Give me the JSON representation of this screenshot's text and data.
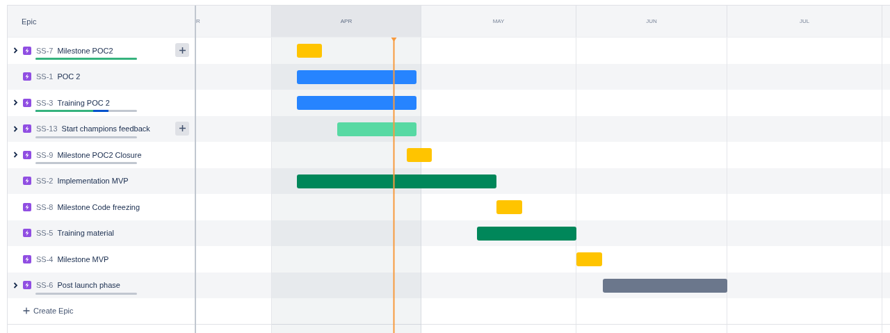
{
  "header": {
    "column": "Epic"
  },
  "months": [
    {
      "label": "R",
      "current": false
    },
    {
      "label": "APR",
      "current": true
    },
    {
      "label": "MAY",
      "current": false
    },
    {
      "label": "JUN",
      "current": false
    },
    {
      "label": "JUL",
      "current": false
    }
  ],
  "epics": [
    {
      "key": "SS-7",
      "title": "Milestone POC2",
      "expandable": true,
      "add_button": true,
      "has_progress": true,
      "progress": {
        "done": {
          "level": 1
        }
      },
      "color": "#ffc400"
    },
    {
      "key": "SS-1",
      "title": "POC 2",
      "expandable": false,
      "add_button": false,
      "has_progress": false,
      "color": "#2684ff"
    },
    {
      "key": "SS-3",
      "title": "Training POC 2",
      "expandable": true,
      "add_button": false,
      "has_progress": true,
      "progress": {
        "done": {
          "level": 0.57
        },
        "done_or_in_progress": {
          "level": 0.72
        }
      },
      "color": "#2684ff"
    },
    {
      "key": "SS-13",
      "title": "Start champions feedback",
      "expandable": true,
      "add_button": true,
      "has_progress": true,
      "color": "#57d9a3"
    },
    {
      "key": "SS-9",
      "title": "Milestone POC2 Closure",
      "expandable": true,
      "add_button": false,
      "has_progress": true,
      "color": "#ffc400"
    },
    {
      "key": "SS-2",
      "title": "Implementation MVP",
      "expandable": false,
      "add_button": false,
      "has_progress": false,
      "color": "#00875a"
    },
    {
      "key": "SS-8",
      "title": "Milestone Code freezing",
      "expandable": false,
      "add_button": false,
      "has_progress": false,
      "color": "#ffc400"
    },
    {
      "key": "SS-5",
      "title": "Training material",
      "expandable": false,
      "add_button": false,
      "has_progress": false,
      "color": "#00875a"
    },
    {
      "key": "SS-4",
      "title": "Milestone MVP",
      "expandable": false,
      "add_button": false,
      "has_progress": false,
      "color": "#ffc400"
    },
    {
      "key": "SS-6",
      "title": "Post launch phase",
      "expandable": true,
      "add_button": false,
      "has_progress": true,
      "color": "#6b778c"
    }
  ],
  "create": {
    "label": "Create Epic"
  }
}
